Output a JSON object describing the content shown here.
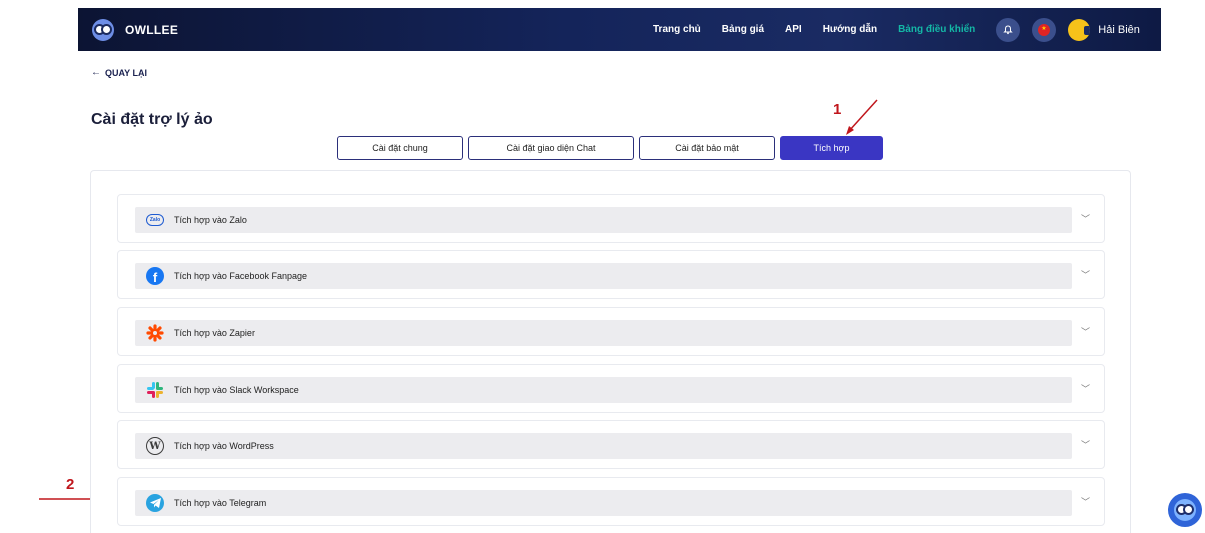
{
  "header": {
    "brand": "OWLLEE",
    "nav": [
      {
        "label": "Trang chủ",
        "active": false
      },
      {
        "label": "Bảng giá",
        "active": false
      },
      {
        "label": "API",
        "active": false
      },
      {
        "label": "Hướng dẫn",
        "active": false
      },
      {
        "label": "Bảng điều khiển",
        "active": true
      }
    ],
    "user_name": "Hải Biên"
  },
  "back_label": "QUAY LẠI",
  "page_title": "Cài đặt trợ lý ảo",
  "tabs": [
    {
      "label": "Cài đặt chung",
      "active": false
    },
    {
      "label": "Cài đặt giao diện Chat",
      "active": false
    },
    {
      "label": "Cài đặt bảo mật",
      "active": false
    },
    {
      "label": "Tích hợp",
      "active": true
    }
  ],
  "annotations": {
    "step1": "1",
    "step2": "2",
    "color": "#c0161c"
  },
  "integrations": [
    {
      "label": "Tích hợp vào Zalo",
      "icon": "zalo-icon"
    },
    {
      "label": "Tích hợp vào Facebook Fanpage",
      "icon": "facebook-icon"
    },
    {
      "label": "Tích hợp vào Zapier",
      "icon": "zapier-icon"
    },
    {
      "label": "Tích hợp vào Slack Workspace",
      "icon": "slack-icon"
    },
    {
      "label": "Tích hợp vào WordPress",
      "icon": "wordpress-icon"
    },
    {
      "label": "Tích hợp vào Telegram",
      "icon": "telegram-icon"
    }
  ],
  "colors": {
    "accent": "#3a36c3",
    "nav_active": "#14b8a6",
    "header_bg": "#14245a"
  }
}
